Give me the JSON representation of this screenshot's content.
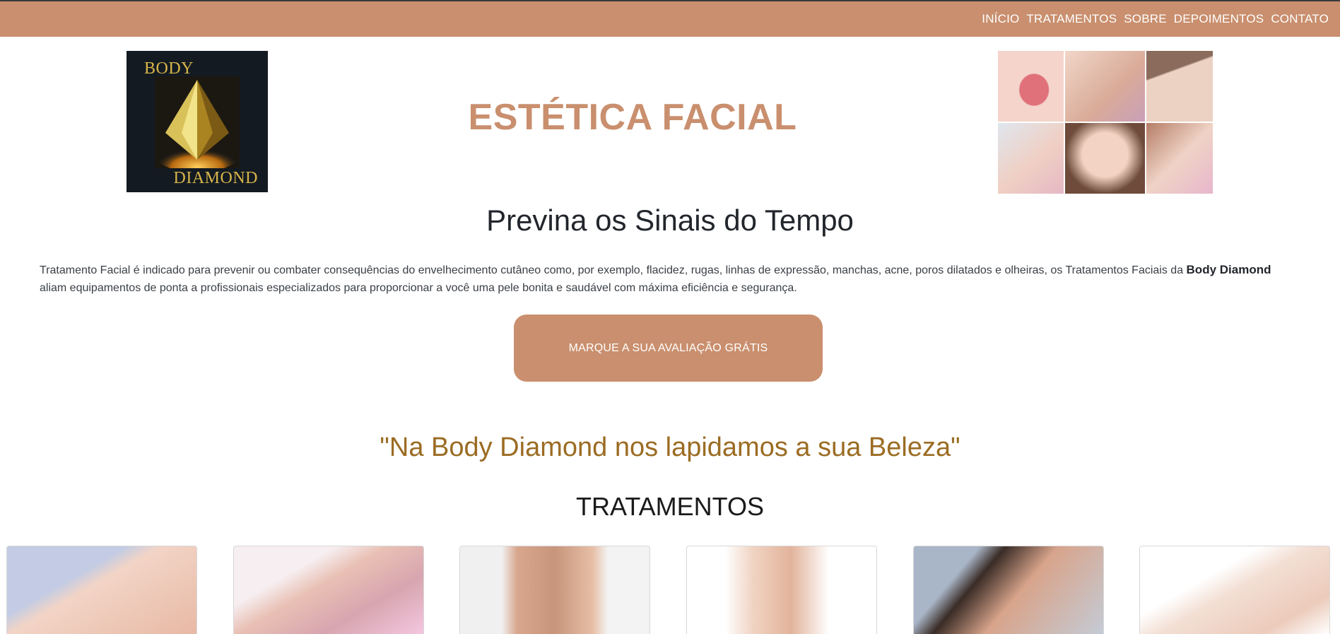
{
  "nav": {
    "items": [
      "INÍCIO",
      "TRATAMENTOS",
      "SOBRE",
      "DEPOIMENTOS",
      "CONTATO"
    ]
  },
  "logo": {
    "text_top": "BODY",
    "text_bottom": "DIAMOND"
  },
  "hero": {
    "title": "ESTÉTICA FACIAL"
  },
  "intro": {
    "subtitle": "Previna os Sinais do Tempo",
    "desc_part1": "Tratamento Facial é indicado para prevenir ou combater consequências do envelhecimento cutâneo como, por exemplo, flacidez, rugas, linhas de expressão, manchas, acne, poros dilatados e olheiras, os Tratamentos Faciais da ",
    "desc_brand": "Body Diamond",
    "desc_part2": " aliam equipamentos de ponta a profissionais especializados para proporcionar a você uma pele bonita e saudável com máxima eficiência e segurança.",
    "cta_label": "MARQUE A SUA AVALIAÇÃO GRÁTIS"
  },
  "quote": "\"Na Body Diamond nos lapidamos a sua Beleza\"",
  "treatments": {
    "title": "TRATAMENTOS"
  },
  "colors": {
    "accent": "#c98f6e",
    "quote": "#9b6c23",
    "logo_bg": "#131a21",
    "logo_gold": "#d8b54a"
  }
}
